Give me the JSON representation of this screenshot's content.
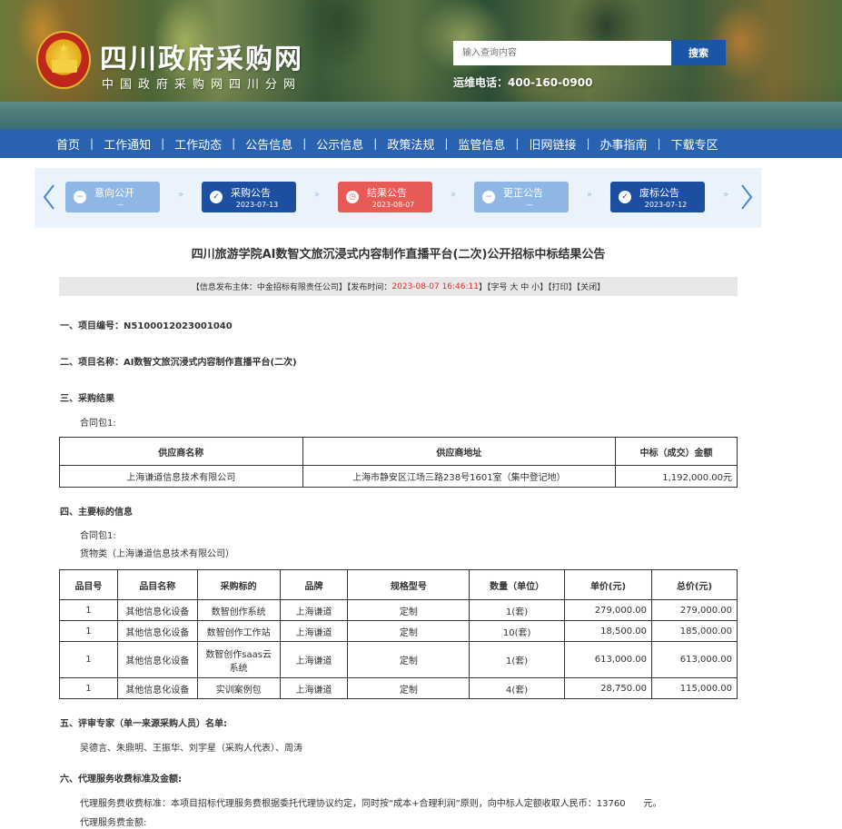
{
  "header": {
    "site_title": "四川政府采购网",
    "site_subtitle": "中国政府采购网四川分网",
    "search_placeholder": "输入查询内容",
    "search_button": "搜索",
    "hotline": "运维电话：400-160-0900"
  },
  "nav": {
    "items": [
      "首页",
      "工作通知",
      "工作动态",
      "公告信息",
      "公示信息",
      "政策法规",
      "监管信息",
      "旧网链接",
      "办事指南",
      "下载专区"
    ]
  },
  "status_steps": [
    {
      "label": "意向公开",
      "date": "—",
      "style": "light"
    },
    {
      "label": "采购公告",
      "date": "2023-07-13",
      "style": "dark"
    },
    {
      "label": "结果公告",
      "date": "2023-08-07",
      "style": "red"
    },
    {
      "label": "更正公告",
      "date": "—",
      "style": "light"
    },
    {
      "label": "废标公告",
      "date": "2023-07-12",
      "style": "dark"
    }
  ],
  "article": {
    "title": "四川旅游学院AI数智文旅沉浸式内容制作直播平台(二次)公开招标中标结果公告",
    "meta": {
      "publisher": "【信息发布主体：中金招标有限责任公司】【发布时间：",
      "publish_time": "2023-08-07 16:46:11",
      "tail": "】【字号 大 中 小】【打印】【关闭】"
    },
    "sec1": "一、项目编号：N5100012023001040",
    "sec2": "二、项目名称：AI数智文旅沉浸式内容制作直播平台(二次)",
    "sec3": "三、采购结果",
    "sec3_package": "合同包1:",
    "result_table": {
      "headers": [
        "供应商名称",
        "供应商地址",
        "中标（成交）金额"
      ],
      "rows": [
        [
          "上海谦道信息技术有限公司",
          "上海市静安区江场三路238号1601室（集中登记地）",
          "1,192,000.00元"
        ]
      ]
    },
    "sec4": "四、主要标的信息",
    "sec4_package": "合同包1:",
    "sec4_type": "货物类（上海谦道信息技术有限公司）",
    "items_table": {
      "headers": [
        "品目号",
        "品目名称",
        "采购标的",
        "品牌",
        "规格型号",
        "数量（单位）",
        "单价(元)",
        "总价(元)"
      ],
      "rows": [
        [
          "1",
          "其他信息化设备",
          "数智创作系统",
          "上海谦道",
          "定制",
          "1(套)",
          "279,000.00",
          "279,000.00"
        ],
        [
          "1",
          "其他信息化设备",
          "数智创作工作站",
          "上海谦道",
          "定制",
          "10(套)",
          "18,500.00",
          "185,000.00"
        ],
        [
          "1",
          "其他信息化设备",
          "数智创作saas云系统",
          "上海谦道",
          "定制",
          "1(套)",
          "613,000.00",
          "613,000.00"
        ],
        [
          "1",
          "其他信息化设备",
          "实训案例包",
          "上海谦道",
          "定制",
          "4(套)",
          "28,750.00",
          "115,000.00"
        ]
      ]
    },
    "sec5": "五、评审专家（单一来源采购人员）名单:",
    "sec5_names": "吴德言、朱鼎明、王振华、刘宇星（采购人代表）、周涛",
    "sec6": "六、代理服务收费标准及金额:",
    "sec6_standard": "代理服务费收费标准：本项目招标代理服务费根据委托代理协议约定，同时按“成本+合理利润”原则，向中标人定额收取人民币：13760　　元。",
    "sec6_amount": "代理服务费金额:"
  }
}
